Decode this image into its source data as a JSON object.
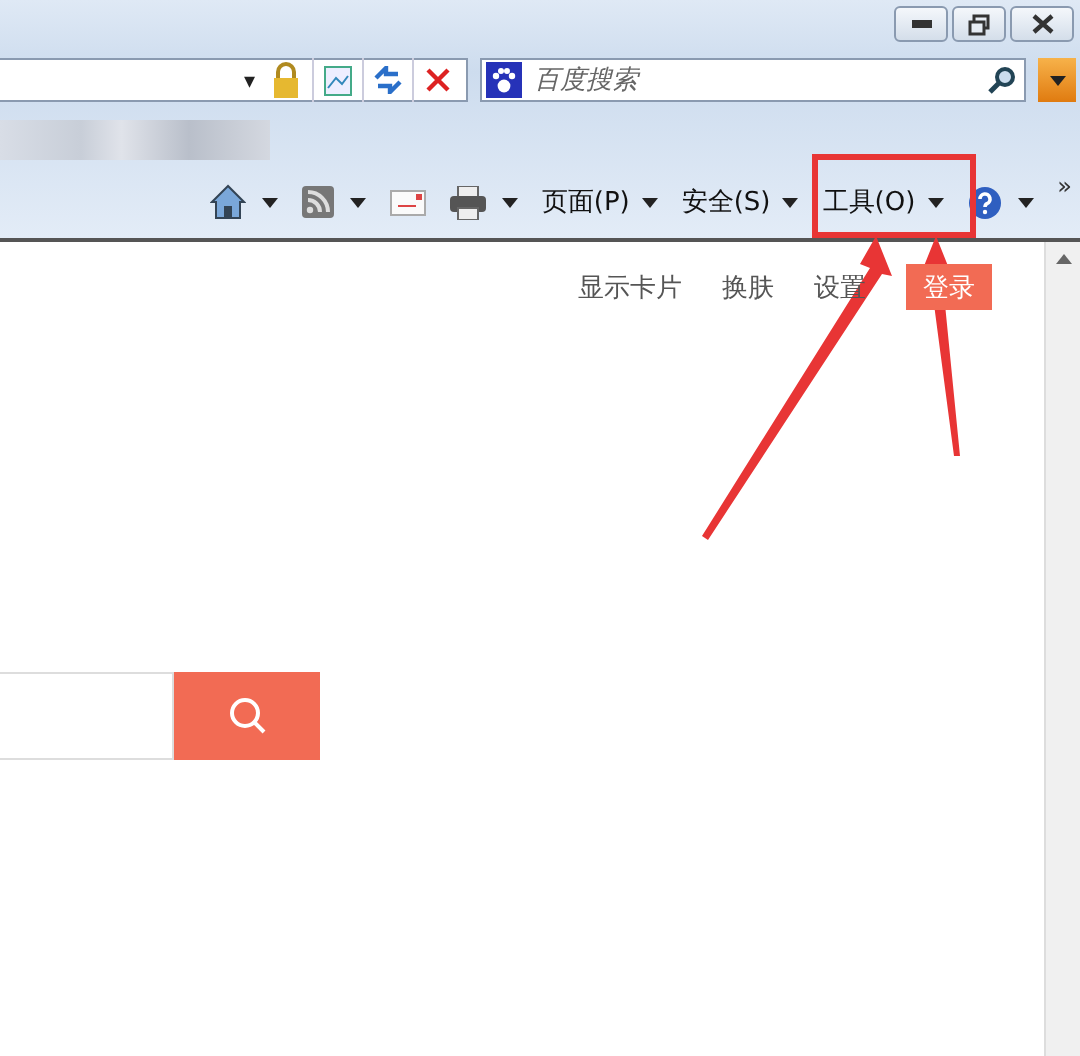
{
  "address_bar": {
    "dropdown": "▾"
  },
  "search": {
    "placeholder": "百度搜索"
  },
  "command_bar": [
    {
      "kind": "home",
      "dropdown": true
    },
    {
      "kind": "feed",
      "dropdown": true
    },
    {
      "kind": "mail",
      "dropdown": false
    },
    {
      "kind": "print",
      "dropdown": true
    },
    {
      "kind": "menu",
      "label": "页面(P)",
      "dropdown": true
    },
    {
      "kind": "menu",
      "label": "安全(S)",
      "dropdown": true
    },
    {
      "kind": "menu",
      "label": "工具(O)",
      "dropdown": true
    },
    {
      "kind": "help",
      "dropdown": true
    }
  ],
  "command_bar_more": "»",
  "page_links": [
    {
      "kind": "link",
      "label": "显示卡片"
    },
    {
      "kind": "link",
      "label": "换肤"
    },
    {
      "kind": "link",
      "label": "设置"
    },
    {
      "kind": "button",
      "label": "登录"
    }
  ]
}
